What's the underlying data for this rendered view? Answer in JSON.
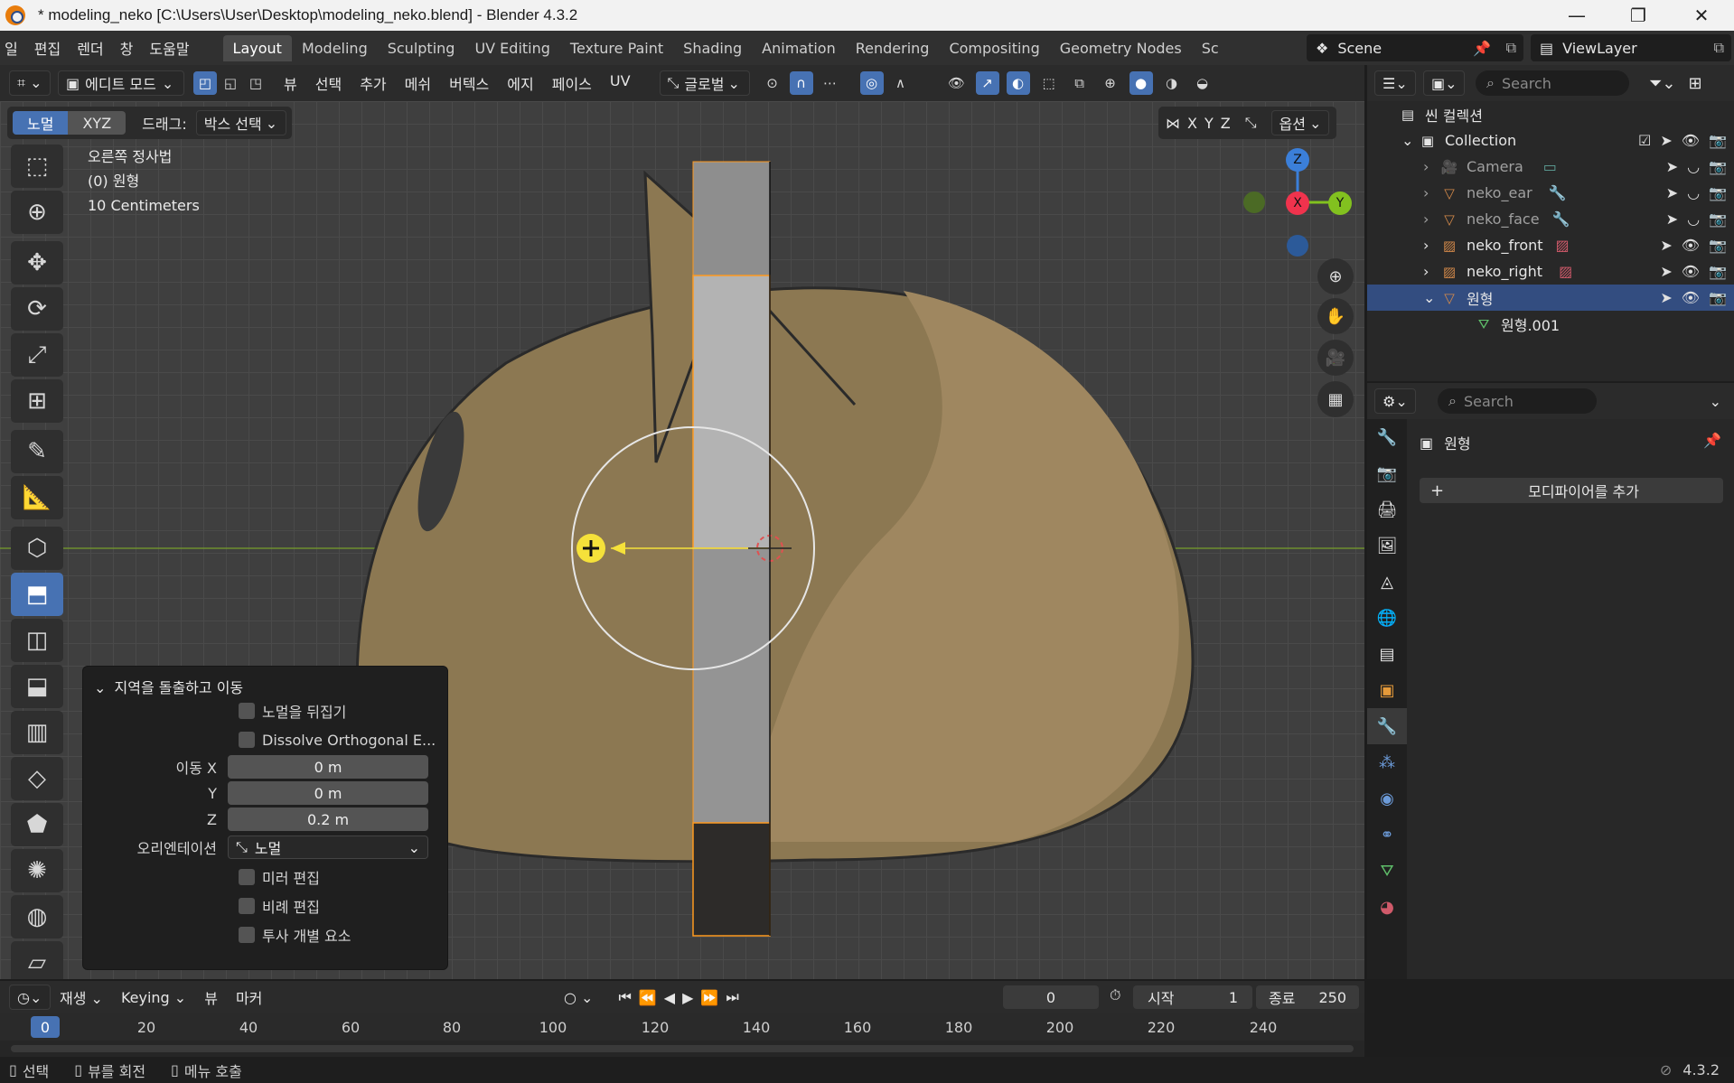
{
  "window": {
    "title": "* modeling_neko [C:\\Users\\User\\Desktop\\modeling_neko.blend] - Blender 4.3.2",
    "minimize": "—",
    "maximize": "❐",
    "close": "✕"
  },
  "menubar": {
    "items": [
      "일",
      "편집",
      "렌더",
      "창",
      "도움말"
    ]
  },
  "workspaces": {
    "tabs": [
      "Layout",
      "Modeling",
      "Sculpting",
      "UV Editing",
      "Texture Paint",
      "Shading",
      "Animation",
      "Rendering",
      "Compositing",
      "Geometry Nodes",
      "Sc"
    ],
    "active": "Layout"
  },
  "scene": {
    "name": "Scene",
    "view_layer": "ViewLayer"
  },
  "viewport_header": {
    "mode": "에디트 모드",
    "menus": [
      "뷰",
      "선택",
      "추가",
      "메쉬",
      "버텍스",
      "에지",
      "페이스",
      "UV"
    ],
    "orientation": "글로벌"
  },
  "viewport_toolbar2": {
    "normal_btn": "노멀",
    "xyz_btn": "XYZ",
    "drag_label": "드래그:",
    "drag_value": "박스 선택",
    "axes": [
      "X",
      "Y",
      "Z"
    ],
    "options": "옵션"
  },
  "viewport_info": {
    "view_name": "오른쪽 정사법",
    "object": "(0) 원형",
    "scale": "10 Centimeters"
  },
  "gizmo": {
    "z": "Z",
    "x": "X",
    "y": "Y"
  },
  "operator_panel": {
    "title": "지역을 돌출하고 이동",
    "flip_normals": "노멀을 뒤집기",
    "dissolve": "Dissolve Orthogonal E...",
    "move_x_label": "이동 X",
    "move_x": "0 m",
    "move_y_label": "Y",
    "move_y": "0 m",
    "move_z_label": "Z",
    "move_z": "0.2 m",
    "orientation_label": "오리엔테이션",
    "orientation_value": "노멀",
    "mirror_edit": "미러 편집",
    "proportional_edit": "비례 편집",
    "project_individual": "투사 개별 요소"
  },
  "outliner": {
    "search_placeholder": "Search",
    "root": "씬 컬렉션",
    "items": [
      {
        "name": "Collection"
      },
      {
        "name": "Camera"
      },
      {
        "name": "neko_ear"
      },
      {
        "name": "neko_face"
      },
      {
        "name": "neko_front"
      },
      {
        "name": "neko_right"
      },
      {
        "name": "원형"
      },
      {
        "name": "원형.001"
      }
    ]
  },
  "properties": {
    "search_placeholder": "Search",
    "object_name": "원형",
    "add_modifier": "모디파이어를 추가"
  },
  "timeline": {
    "playback": "재생",
    "keying": "Keying",
    "view": "뷰",
    "marker": "마커",
    "current_frame": "0",
    "start_label": "시작",
    "start": "1",
    "end_label": "종료",
    "end": "250",
    "ruler_current": "0",
    "ticks": [
      "20",
      "40",
      "60",
      "80",
      "100",
      "120",
      "140",
      "160",
      "180",
      "200",
      "220",
      "240"
    ]
  },
  "statusbar": {
    "select": "선택",
    "rotate_view": "뷰를 회전",
    "call_menu": "메뉴 호출",
    "version": "4.3.2"
  },
  "colors": {
    "accent": "#4772b3",
    "selection": "#334d80",
    "edit_orange": "#ff9a1f",
    "gizmo_x": "#f0334d",
    "gizmo_y": "#82c11f",
    "gizmo_z": "#3b7fd9"
  }
}
